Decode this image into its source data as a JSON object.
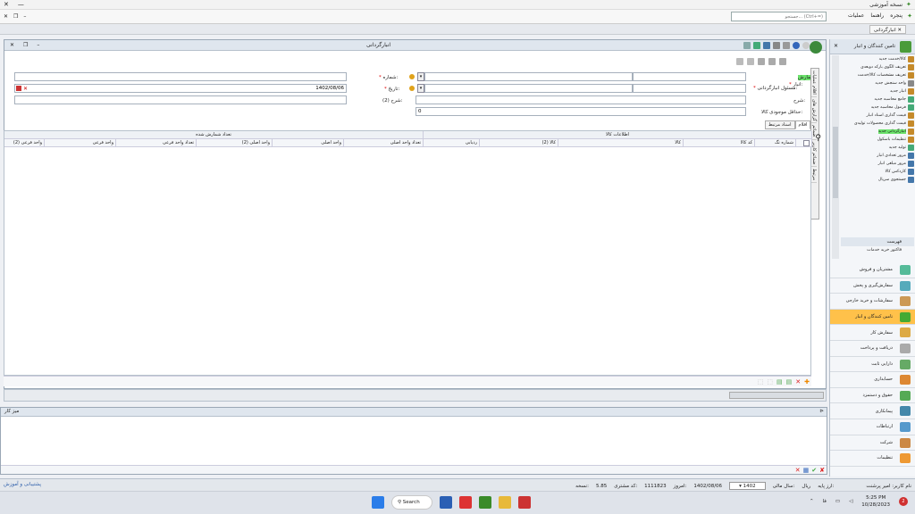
{
  "app": {
    "title": "نسخه آموزشی",
    "window_controls": {
      "close": "✕",
      "minimize": "—"
    }
  },
  "menu": {
    "items": [
      "عملیات",
      "راهنما",
      "پنجره"
    ],
    "search_placeholder": "جستجو... (Ctrl+=)"
  },
  "doc_tab": {
    "label": "انبارگردانی"
  },
  "document": {
    "title": "انبارگردانی"
  },
  "form": {
    "number_label": "شماره:",
    "date_label": "تاریخ:",
    "date_value": "1402/08/06",
    "count_label": "شمارش",
    "warehouse_label": "انبار:",
    "responsible_label": "مسئول انبارگردانی:",
    "desc_label": "شرح:",
    "desc2_label": "شرح (2):",
    "min_stock_label": "حداقل موجودی کالا:",
    "min_stock_value": "0"
  },
  "side_tabs": [
    "اقلام عملیات",
    "گزارش های",
    "ضمائم",
    "ضمائم کاربر",
    "مرتبط"
  ],
  "grid": {
    "tabs": [
      "اقلام",
      "اسناد مرتبط"
    ],
    "groups": [
      "اطلاعات کالا",
      "تعداد شمارش شده"
    ],
    "columns": [
      "شماره تگ",
      "کد کالا",
      "کالا",
      "کالا (2)",
      "ردیابی",
      "تعداد واحد اصلی",
      "واحد اصلی",
      "واحد اصلی (2)",
      "تعداد واحد فرعی",
      "واحد فرعی",
      "واحد فرعی (2)"
    ]
  },
  "panel2": {
    "title": "میز کار"
  },
  "nav": {
    "title": "تامین کنندگان و انبار",
    "items": [
      "کالا/خدمت جدید",
      "تعریف الگوی بارکد دوبعدی",
      "تعریف مشخصات کالا/خدمت",
      "واحد سنجش جدید",
      "انبار جدید",
      "جامع محاسبه جدید",
      "فرمول محاسبه جدید",
      "قیمت گذاری اسناد انبار",
      "قیمت گذاری محصولات تولیدی",
      "انبارگردانی جدید",
      "تنظیمات باسکول",
      "تولید جدید",
      "مرور تعدادی انبار",
      "مرور مبلغی انبار",
      "کاردکس کالا",
      "جستجوی سریال"
    ],
    "active_item": "انبارگردانی جدید",
    "section": "فهرست",
    "section_item": "فاکتور خرید خدمات",
    "modules": [
      "مشتریان و فروش",
      "سفارش‌گیری و پخش",
      "سفارشات و خرید خارجی",
      "تامین کنندگان و انبار",
      "سفارش کار",
      "دریافت و پرداخت",
      "دارایی ثابت",
      "حسابداری",
      "حقوق و دستمزد",
      "پیمانکاری",
      "ارتباطات",
      "شرکت",
      "تنظیمات"
    ],
    "active_module": "تامین کنندگان و انبار"
  },
  "status": {
    "support": "پشتیبانی و آموزش",
    "user": "نام کاربر: امیر پرشنت",
    "db_label": "ارز پایه:",
    "currency": "ریال",
    "fiscal_label": "سال مالی:",
    "fiscal_year": "1402",
    "today_label": "امروز:",
    "today": "1402/08/06",
    "code_label": "کد مشتری:",
    "code": "1111823",
    "version_label": "نسخه:",
    "version": "5.85"
  },
  "taskbar": {
    "search": "Search",
    "time": "5:25 PM",
    "date": "10/28/2023",
    "notif": "2"
  },
  "colors": {
    "highlight": "#6ce36c",
    "active_module": "#ffc14a",
    "accent": "#2a5caa"
  }
}
